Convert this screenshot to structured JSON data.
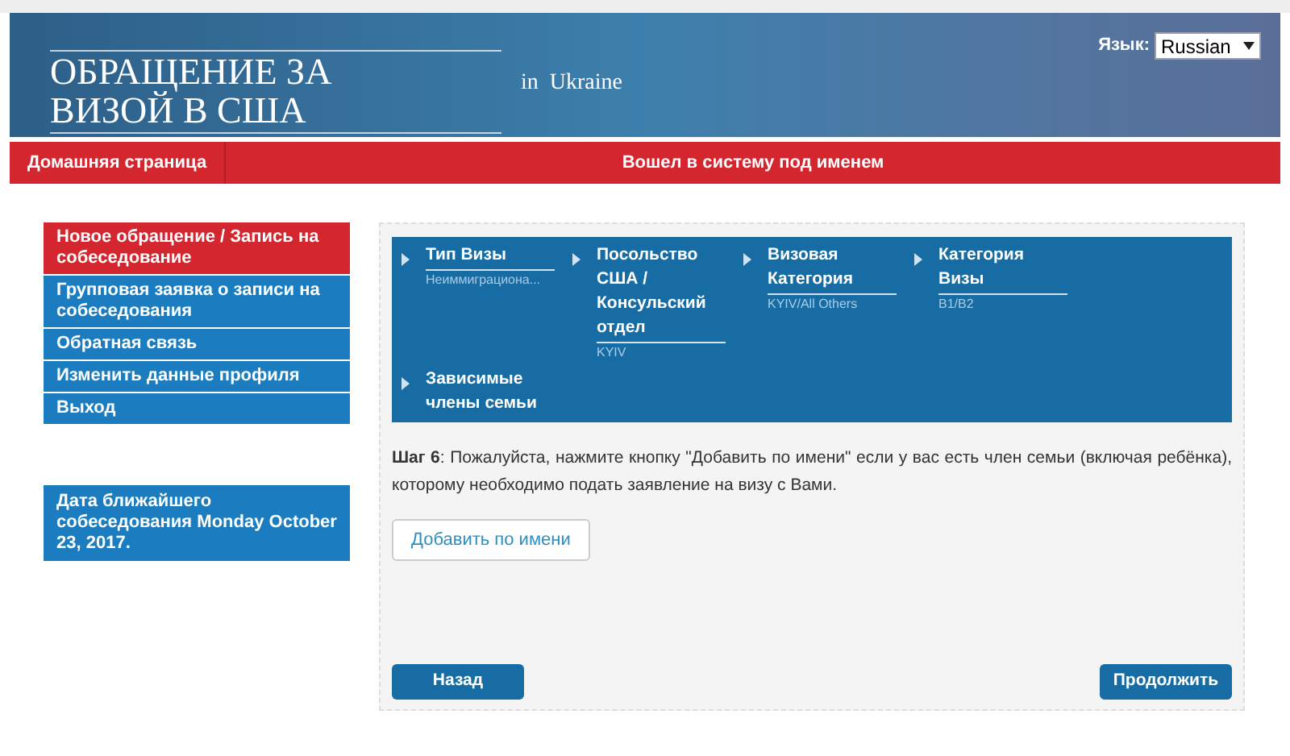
{
  "header": {
    "title_line_1": "ОБРАЩЕНИЕ ЗА",
    "title_line_2": "ВИЗОЙ В США",
    "country": "in  Ukraine",
    "language_label": "Язык:",
    "language": "Russian"
  },
  "nav": {
    "home": "Домашняя страница",
    "login_status": "Вошел в систему под именем"
  },
  "sidebar": {
    "items": [
      {
        "label": "Новое обращение / Запись на собеседование",
        "selected": true
      },
      {
        "label": "Групповая заявка о записи на собеседования",
        "selected": false
      },
      {
        "label": "Обратная связь",
        "selected": false
      },
      {
        "label": "Изменить данные профиля",
        "selected": false
      },
      {
        "label": "Выход",
        "selected": false
      }
    ],
    "appointment": "Дата ближайшего собеседования Monday October 23, 2017."
  },
  "steps": [
    {
      "title": "Тип Визы",
      "value": "Неиммиграциона..."
    },
    {
      "title": "Посольство США / Консульский отдел",
      "value": "KYIV"
    },
    {
      "title": "Визовая Категория",
      "value": "KYIV/All Others"
    },
    {
      "title": "Категория Визы",
      "value": "B1/B2"
    },
    {
      "title": "Зависимые члены семьи"
    }
  ],
  "instruction": "**Шаг 6**: Пожалуйста, нажмите кнопку \"Добавить по имени\" если у вас есть член семьи (включая ребёнка), которому необходимо подать заявление на визу с Вами.",
  "add_button": "Добавить по имени",
  "back_button": "Назад",
  "continue_button": "Продолжить"
}
